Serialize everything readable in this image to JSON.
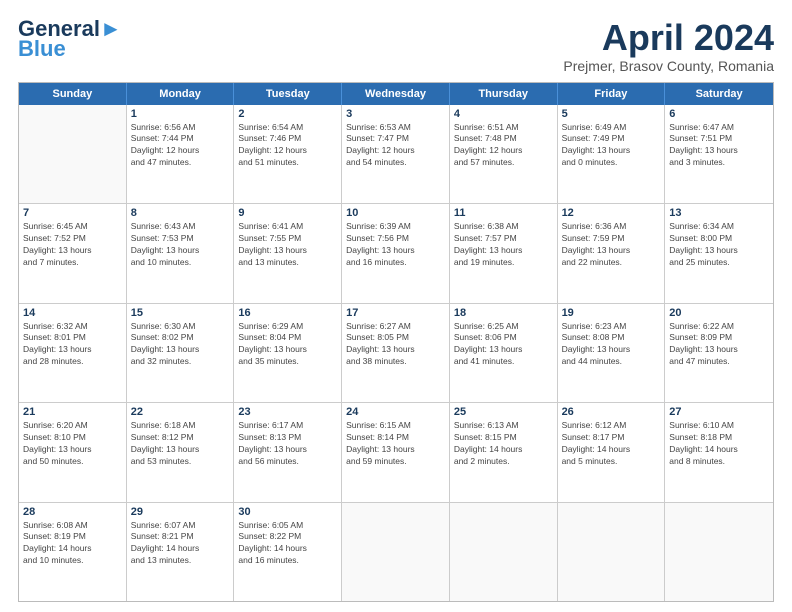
{
  "logo": {
    "line1": "General",
    "line2": "Blue"
  },
  "title": "April 2024",
  "location": "Prejmer, Brasov County, Romania",
  "headers": [
    "Sunday",
    "Monday",
    "Tuesday",
    "Wednesday",
    "Thursday",
    "Friday",
    "Saturday"
  ],
  "weeks": [
    [
      {
        "day": "",
        "info": ""
      },
      {
        "day": "1",
        "info": "Sunrise: 6:56 AM\nSunset: 7:44 PM\nDaylight: 12 hours\nand 47 minutes."
      },
      {
        "day": "2",
        "info": "Sunrise: 6:54 AM\nSunset: 7:46 PM\nDaylight: 12 hours\nand 51 minutes."
      },
      {
        "day": "3",
        "info": "Sunrise: 6:53 AM\nSunset: 7:47 PM\nDaylight: 12 hours\nand 54 minutes."
      },
      {
        "day": "4",
        "info": "Sunrise: 6:51 AM\nSunset: 7:48 PM\nDaylight: 12 hours\nand 57 minutes."
      },
      {
        "day": "5",
        "info": "Sunrise: 6:49 AM\nSunset: 7:49 PM\nDaylight: 13 hours\nand 0 minutes."
      },
      {
        "day": "6",
        "info": "Sunrise: 6:47 AM\nSunset: 7:51 PM\nDaylight: 13 hours\nand 3 minutes."
      }
    ],
    [
      {
        "day": "7",
        "info": "Sunrise: 6:45 AM\nSunset: 7:52 PM\nDaylight: 13 hours\nand 7 minutes."
      },
      {
        "day": "8",
        "info": "Sunrise: 6:43 AM\nSunset: 7:53 PM\nDaylight: 13 hours\nand 10 minutes."
      },
      {
        "day": "9",
        "info": "Sunrise: 6:41 AM\nSunset: 7:55 PM\nDaylight: 13 hours\nand 13 minutes."
      },
      {
        "day": "10",
        "info": "Sunrise: 6:39 AM\nSunset: 7:56 PM\nDaylight: 13 hours\nand 16 minutes."
      },
      {
        "day": "11",
        "info": "Sunrise: 6:38 AM\nSunset: 7:57 PM\nDaylight: 13 hours\nand 19 minutes."
      },
      {
        "day": "12",
        "info": "Sunrise: 6:36 AM\nSunset: 7:59 PM\nDaylight: 13 hours\nand 22 minutes."
      },
      {
        "day": "13",
        "info": "Sunrise: 6:34 AM\nSunset: 8:00 PM\nDaylight: 13 hours\nand 25 minutes."
      }
    ],
    [
      {
        "day": "14",
        "info": "Sunrise: 6:32 AM\nSunset: 8:01 PM\nDaylight: 13 hours\nand 28 minutes."
      },
      {
        "day": "15",
        "info": "Sunrise: 6:30 AM\nSunset: 8:02 PM\nDaylight: 13 hours\nand 32 minutes."
      },
      {
        "day": "16",
        "info": "Sunrise: 6:29 AM\nSunset: 8:04 PM\nDaylight: 13 hours\nand 35 minutes."
      },
      {
        "day": "17",
        "info": "Sunrise: 6:27 AM\nSunset: 8:05 PM\nDaylight: 13 hours\nand 38 minutes."
      },
      {
        "day": "18",
        "info": "Sunrise: 6:25 AM\nSunset: 8:06 PM\nDaylight: 13 hours\nand 41 minutes."
      },
      {
        "day": "19",
        "info": "Sunrise: 6:23 AM\nSunset: 8:08 PM\nDaylight: 13 hours\nand 44 minutes."
      },
      {
        "day": "20",
        "info": "Sunrise: 6:22 AM\nSunset: 8:09 PM\nDaylight: 13 hours\nand 47 minutes."
      }
    ],
    [
      {
        "day": "21",
        "info": "Sunrise: 6:20 AM\nSunset: 8:10 PM\nDaylight: 13 hours\nand 50 minutes."
      },
      {
        "day": "22",
        "info": "Sunrise: 6:18 AM\nSunset: 8:12 PM\nDaylight: 13 hours\nand 53 minutes."
      },
      {
        "day": "23",
        "info": "Sunrise: 6:17 AM\nSunset: 8:13 PM\nDaylight: 13 hours\nand 56 minutes."
      },
      {
        "day": "24",
        "info": "Sunrise: 6:15 AM\nSunset: 8:14 PM\nDaylight: 13 hours\nand 59 minutes."
      },
      {
        "day": "25",
        "info": "Sunrise: 6:13 AM\nSunset: 8:15 PM\nDaylight: 14 hours\nand 2 minutes."
      },
      {
        "day": "26",
        "info": "Sunrise: 6:12 AM\nSunset: 8:17 PM\nDaylight: 14 hours\nand 5 minutes."
      },
      {
        "day": "27",
        "info": "Sunrise: 6:10 AM\nSunset: 8:18 PM\nDaylight: 14 hours\nand 8 minutes."
      }
    ],
    [
      {
        "day": "28",
        "info": "Sunrise: 6:08 AM\nSunset: 8:19 PM\nDaylight: 14 hours\nand 10 minutes."
      },
      {
        "day": "29",
        "info": "Sunrise: 6:07 AM\nSunset: 8:21 PM\nDaylight: 14 hours\nand 13 minutes."
      },
      {
        "day": "30",
        "info": "Sunrise: 6:05 AM\nSunset: 8:22 PM\nDaylight: 14 hours\nand 16 minutes."
      },
      {
        "day": "",
        "info": ""
      },
      {
        "day": "",
        "info": ""
      },
      {
        "day": "",
        "info": ""
      },
      {
        "day": "",
        "info": ""
      }
    ]
  ]
}
